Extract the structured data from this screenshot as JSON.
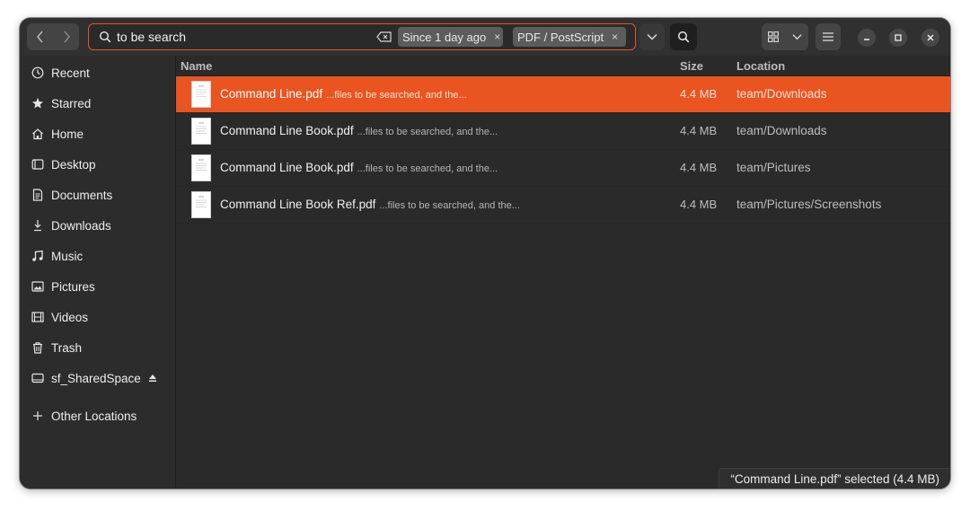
{
  "search": {
    "query": "to be search",
    "filters": [
      {
        "label": "Since 1 day ago",
        "close": "×"
      },
      {
        "label": "PDF / PostScript",
        "close": "×"
      }
    ]
  },
  "colors": {
    "accent": "#e95420",
    "window_bg": "#2c2c2c",
    "headerbar_bg": "#303030"
  },
  "sidebar": {
    "items": [
      {
        "label": "Recent",
        "icon": "clock-icon"
      },
      {
        "label": "Starred",
        "icon": "star-icon"
      },
      {
        "label": "Home",
        "icon": "home-icon"
      },
      {
        "label": "Desktop",
        "icon": "desktop-icon"
      },
      {
        "label": "Documents",
        "icon": "document-icon"
      },
      {
        "label": "Downloads",
        "icon": "download-icon"
      },
      {
        "label": "Music",
        "icon": "music-icon"
      },
      {
        "label": "Pictures",
        "icon": "picture-icon"
      },
      {
        "label": "Videos",
        "icon": "video-icon"
      },
      {
        "label": "Trash",
        "icon": "trash-icon"
      },
      {
        "label": "sf_SharedSpace",
        "icon": "drive-icon"
      },
      {
        "label": "Other Locations",
        "icon": "plus-icon"
      }
    ]
  },
  "columns": {
    "name": "Name",
    "size": "Size",
    "location": "Location"
  },
  "files": [
    {
      "name": "Command Line.pdf",
      "snippet": "...files to be searched, and the...",
      "size": "4.4 MB",
      "location": "team/Downloads"
    },
    {
      "name": "Command Line Book.pdf",
      "snippet": "...files to be searched, and the...",
      "size": "4.4 MB",
      "location": "team/Downloads"
    },
    {
      "name": "Command Line Book.pdf",
      "snippet": "...files to be searched, and the...",
      "size": "4.4 MB",
      "location": "team/Pictures"
    },
    {
      "name": "Command Line Book Ref.pdf",
      "snippet": "...files to be searched, and the...",
      "size": "4.4 MB",
      "location": "team/Pictures/Screenshots"
    }
  ],
  "selected_index": 0,
  "status": {
    "text": "“Command Line.pdf” selected  (4.4 MB)"
  }
}
